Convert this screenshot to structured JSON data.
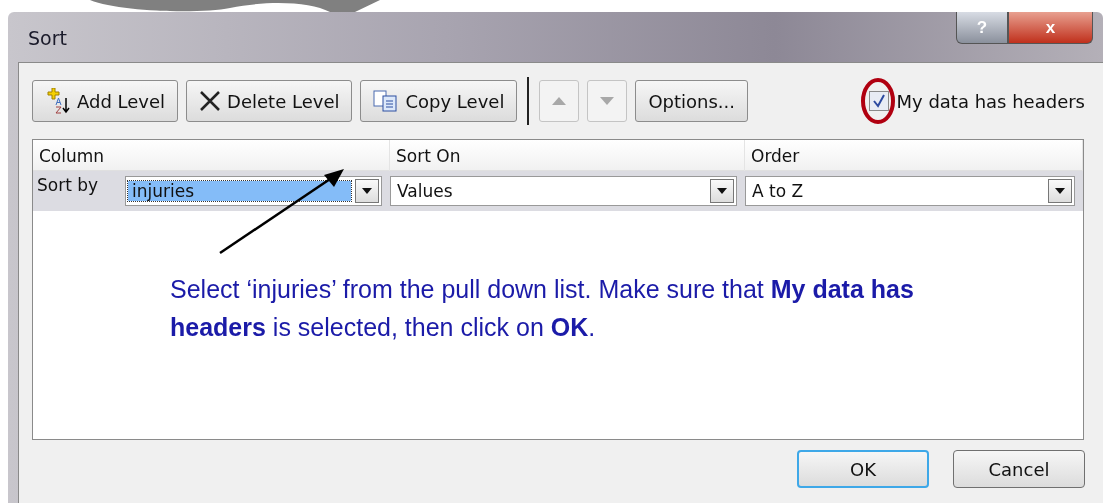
{
  "window": {
    "title": "Sort",
    "caption_buttons": [
      {
        "kind": "help",
        "label": "?"
      },
      {
        "kind": "close",
        "label": "x"
      }
    ]
  },
  "toolbar": [
    {
      "kind": "add",
      "label": "Add Level",
      "disabled": false
    },
    {
      "kind": "delete",
      "label": "Delete Level",
      "disabled": false
    },
    {
      "kind": "copy",
      "label": "Copy Level",
      "disabled": false
    },
    {
      "kind": "up",
      "disabled": true
    },
    {
      "kind": "down",
      "disabled": true
    },
    {
      "kind": "text",
      "label": "Options...",
      "disabled": false
    }
  ],
  "headers_checkbox": {
    "label": "My data has headers",
    "checked": true,
    "highlighted": true
  },
  "table": {
    "columns": [
      "Column",
      "Sort On",
      "Order"
    ],
    "rows": [
      {
        "label": "Sort by",
        "column": "injuries",
        "sort_on": "Values",
        "order": "A to Z",
        "selected": true
      }
    ]
  },
  "annotation": "Select ‘injuries’ from the pull down list. Make sure that **My data has headers** is selected, then click on **OK**.",
  "buttons": [
    {
      "label": "OK",
      "default": true
    },
    {
      "label": "Cancel",
      "default": false
    }
  ]
}
